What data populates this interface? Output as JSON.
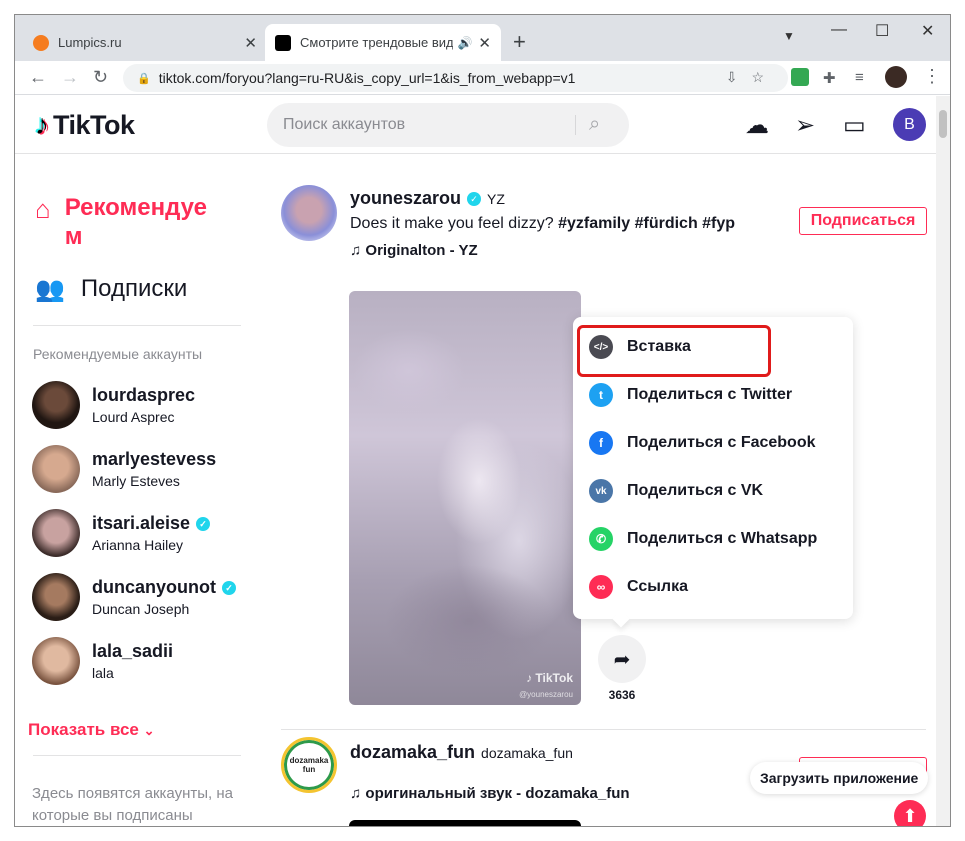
{
  "browser": {
    "tabs": [
      {
        "title": "Lumpics.ru",
        "close": "✕"
      },
      {
        "title": "Смотрите трендовые виде",
        "close": "✕"
      }
    ],
    "new_tab": "+",
    "url": "tiktok.com/foryou?lang=ru-RU&is_copy_url=1&is_from_webapp=v1"
  },
  "header": {
    "logo_text": "TikTok",
    "search_placeholder": "Поиск аккаунтов",
    "avatar_letter": "B"
  },
  "sidebar": {
    "nav": [
      {
        "label": "Рекомендуем"
      },
      {
        "label": "Подписки"
      }
    ],
    "section_title": "Рекомендуемые аккаунты",
    "accounts": [
      {
        "username": "lourdasprec",
        "name": "Lourd Asprec",
        "verified": false
      },
      {
        "username": "marlyestevess",
        "name": "Marly Esteves",
        "verified": false
      },
      {
        "username": "itsari.aleise",
        "name": "Arianna Hailey",
        "verified": true
      },
      {
        "username": "duncanyounot",
        "name": "Duncan Joseph",
        "verified": true
      },
      {
        "username": "lala_sadii",
        "name": "lala",
        "verified": false
      }
    ],
    "show_all": "Показать все",
    "hint": "Здесь появятся аккаунты, на которые вы подписаны"
  },
  "feed": {
    "posts": [
      {
        "username": "youneszarou",
        "display_name": "YZ",
        "desc_text": "Does it make you feel dizzy?",
        "hashtags": "#yzfamily #fürdich #fyp",
        "music": "Originalton - YZ",
        "follow": "Подписаться",
        "watermark": "TikTok",
        "watermark_user": "@youneszarou",
        "share_count": "3636"
      },
      {
        "username": "dozamaka_fun",
        "display_name": "dozamaka_fun",
        "music": "оригинальный звук - dozamaka_fun",
        "avatar_text": "dozamaka fun"
      }
    ]
  },
  "share_menu": {
    "items": [
      {
        "label": "Вставка",
        "icon": "embed-icon",
        "color": "#4a4a52"
      },
      {
        "label": "Поделиться с Twitter",
        "icon": "twitter-icon",
        "color": "#1da1f2"
      },
      {
        "label": "Поделиться с Facebook",
        "icon": "facebook-icon",
        "color": "#1877f2"
      },
      {
        "label": "Поделиться с VK",
        "icon": "vk-icon",
        "color": "#4a76a8"
      },
      {
        "label": "Поделиться с Whatsapp",
        "icon": "whatsapp-icon",
        "color": "#25d366"
      },
      {
        "label": "Ссылка",
        "icon": "link-icon",
        "color": "#fe2c55"
      }
    ]
  },
  "get_app": "Загрузить приложение",
  "colors": {
    "accent": "#fe2c55",
    "verified": "#20d5ec",
    "highlight": "#e01b1b"
  }
}
